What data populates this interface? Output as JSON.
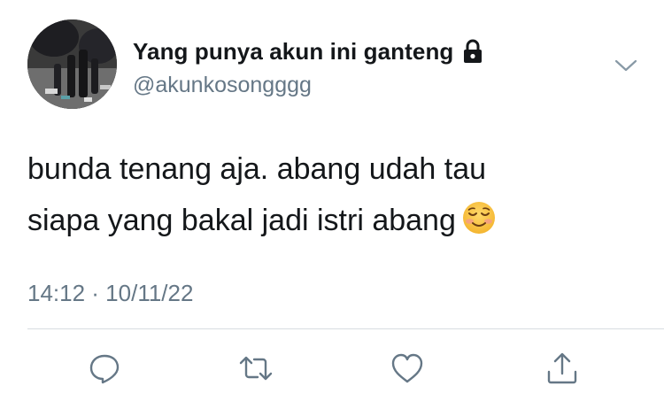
{
  "tweet": {
    "display_name": "Yang punya akun ini ganteng",
    "handle": "@akunkosongggg",
    "protected_icon": "lock-icon",
    "text_lines": [
      "bunda tenang aja. abang udah tau",
      "siapa yang bakal jadi istri abang"
    ],
    "emoji": "smiling-face-icon",
    "timestamp": "14:12 · 10/11/22"
  },
  "actions": {
    "reply_icon": "reply-icon",
    "retweet_icon": "retweet-icon",
    "like_icon": "heart-icon",
    "share_icon": "share-icon"
  },
  "colors": {
    "primary_text": "#14171a",
    "secondary_text": "#657786",
    "divider": "#d8dde1",
    "icon": "#657786"
  }
}
